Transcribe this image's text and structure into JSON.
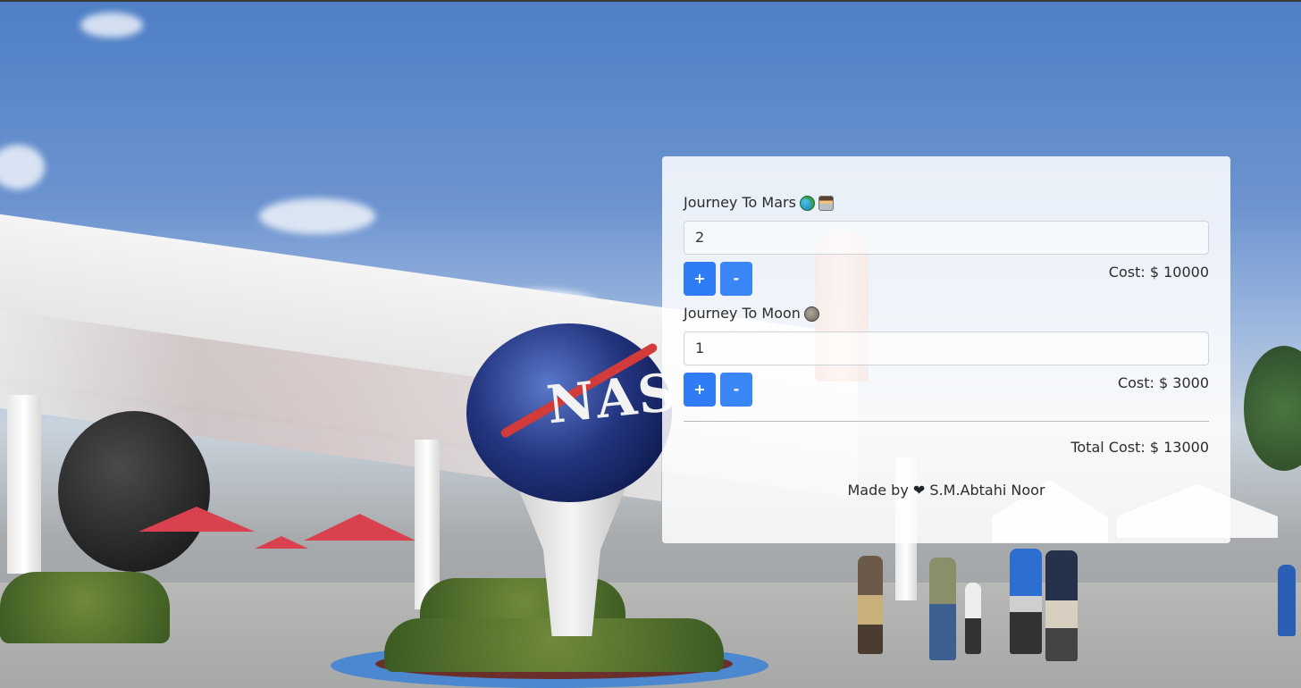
{
  "mars": {
    "label": "Journey To Mars",
    "icons": [
      "globe-icon",
      "astronaut-icon"
    ],
    "quantity": "2",
    "cost_label": "Cost: $ 10000"
  },
  "moon": {
    "label": "Journey To Moon",
    "icons": [
      "moon-icon"
    ],
    "quantity": "1",
    "cost_label": "Cost: $ 3000"
  },
  "buttons": {
    "increment": "+",
    "decrement": "-"
  },
  "total": {
    "label": "Total Cost: $ 13000"
  },
  "footer": {
    "prefix": "Made by",
    "heart": "❤",
    "author": "S.M.Abtahi Noor"
  },
  "colors": {
    "button": "#2f7cf6",
    "card_background": "rgba(255,255,255,0.86)"
  }
}
